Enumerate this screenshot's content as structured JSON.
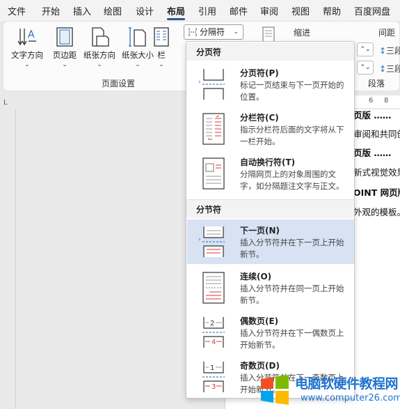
{
  "tabs": [
    "文件",
    "开始",
    "插入",
    "绘图",
    "设计",
    "布局",
    "引用",
    "邮件",
    "审阅",
    "视图",
    "帮助",
    "百度网盘"
  ],
  "active_tab": "布局",
  "ribbon": {
    "buttons": [
      {
        "label": "文字方向",
        "icon": "text-direction-icon"
      },
      {
        "label": "页边距",
        "icon": "margins-icon"
      },
      {
        "label": "纸张方向",
        "icon": "orientation-icon"
      },
      {
        "label": "纸张大小",
        "icon": "paper-size-icon"
      },
      {
        "label": "栏",
        "icon": "columns-icon"
      }
    ],
    "group_label": "页面设置",
    "breaks_button": "分隔符",
    "indent_label": "缩进",
    "spacing_label": "间距",
    "spacing_before_unit": "段",
    "spacing_after_unit": "段",
    "paragraph_label": "段落"
  },
  "ruler": {
    "numbers": [
      "6",
      "8"
    ],
    "corner": "L"
  },
  "document_lines": [
    "页版 ……",
    "审阅和共同创",
    "页版 ……",
    "新式视觉效果",
    "OINT 网页版",
    "外观的模板。"
  ],
  "dropdown": {
    "page_breaks_header": "分页符",
    "section_breaks_header": "分节符",
    "items": [
      {
        "title": "分页符(P)",
        "desc": "标记一页结束与下一页开始的位置。",
        "icon": "page-break-icon"
      },
      {
        "title": "分栏符(C)",
        "desc": "指示分栏符后面的文字将从下一栏开始。",
        "icon": "column-break-icon"
      },
      {
        "title": "自动换行符(T)",
        "desc": "分隔网页上的对象周围的文字，如分隔题注文字与正文。",
        "icon": "text-wrapping-break-icon"
      },
      {
        "title": "下一页(N)",
        "desc": "插入分节符并在下一页上开始新节。",
        "icon": "next-page-section-icon"
      },
      {
        "title": "连续(O)",
        "desc": "插入分节符并在同一页上开始新节。",
        "icon": "continuous-section-icon"
      },
      {
        "title": "偶数页(E)",
        "desc": "插入分节符并在下一偶数页上开始新节。",
        "icon": "even-page-section-icon"
      },
      {
        "title": "奇数页(D)",
        "desc": "插入分节符并在下一奇数页上开始新节。",
        "icon": "odd-page-section-icon"
      }
    ]
  },
  "watermark": {
    "title": "电脑软硬件教程网",
    "url": "www.computer26.com"
  },
  "colors": {
    "accent": "#2b5797",
    "highlight": "#d7e3f3",
    "red_mark": "#d9393a"
  }
}
